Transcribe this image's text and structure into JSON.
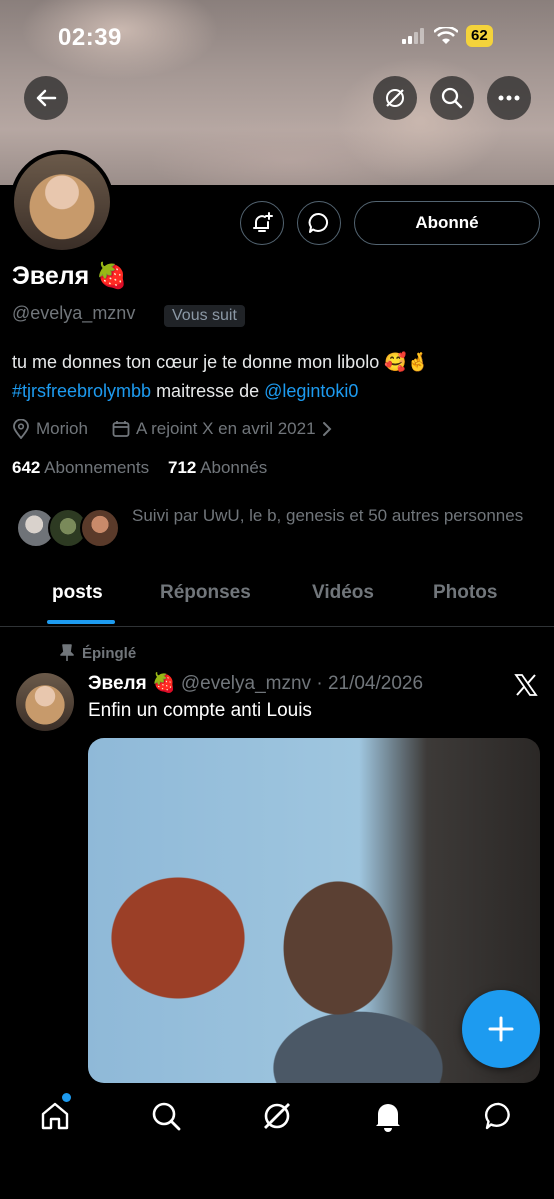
{
  "status_bar": {
    "time": "02:39",
    "battery": "62"
  },
  "profile": {
    "name": "Эвеля 🍓",
    "handle": "@evelya_mznv",
    "follows_you": "Vous suit",
    "follow_button": "Abonné",
    "bio_text_1": "tu me donnes ton cœur je te donne mon libolo 🥰🤞",
    "bio_hashtag": "#tjrsfreebrolymbb",
    "bio_middle": " maitresse de ",
    "bio_mention": "@legintoki0",
    "location": "Morioh",
    "joined": "A rejoint X en avril 2021",
    "following_count": "642",
    "following_label": "Abonnements",
    "followers_count": "712",
    "followers_label": "Abonnés",
    "followed_by": "Suivi par UwU, le b, genesis et 50 autres personnes"
  },
  "tabs": [
    "posts",
    "Réponses",
    "Vidéos",
    "Photos"
  ],
  "post": {
    "pinned_label": "Épinglé",
    "author": "Эвеля 🍓",
    "handle_date": "@evelya_mznv · 21/04/2026",
    "text": "Enfin un compte anti Louis"
  },
  "icons": {
    "back": "arrow-left-icon",
    "grok": "grok-icon",
    "search": "search-icon",
    "more": "more-icon",
    "notify": "bell-plus-icon",
    "message": "message-icon",
    "location": "location-pin-icon",
    "calendar": "calendar-icon",
    "pin": "pin-icon",
    "x_logo": "x-logo-icon",
    "compose": "plus-icon"
  },
  "colors": {
    "accent": "#1d9bf0",
    "muted": "#71767b",
    "background": "#000000"
  }
}
